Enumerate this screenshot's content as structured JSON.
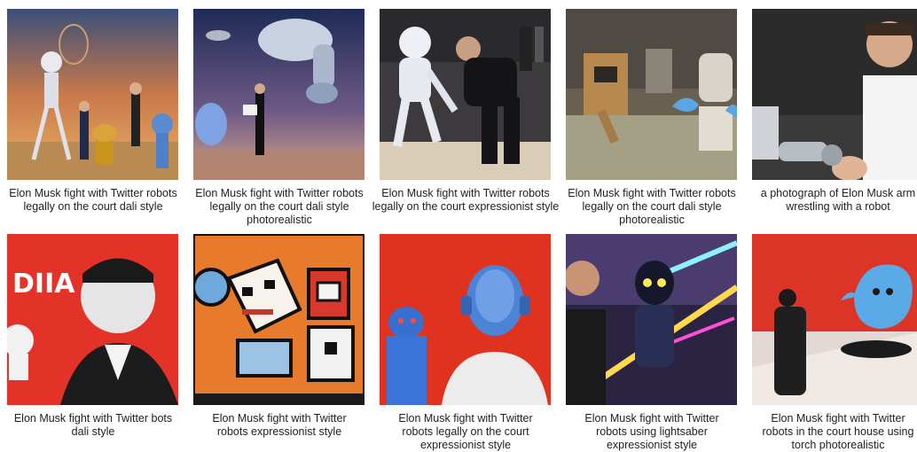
{
  "gallery": {
    "items": [
      {
        "caption": "Elon Musk fight with Twitter robots\nlegally on the court dali style",
        "image": "surreal-robot-scene"
      },
      {
        "caption": "Elon Musk fight with Twitter robots\nlegally on the court dali style\nphotorealistic",
        "image": "robot-arm-sky-scene"
      },
      {
        "caption": "Elon Musk fight with Twitter robots\nlegally on the court expressionist style",
        "image": "musk-vs-white-robot"
      },
      {
        "caption": "Elon Musk fight with Twitter robots\nlegally on the court dali style\nphotorealistic",
        "image": "robots-in-arena"
      },
      {
        "caption": "a photograph of Elon Musk arm\nwrestling with a robot",
        "image": "arm-wrestling-photo"
      },
      {
        "caption": "Elon Musk fight with Twitter bots\ndali style",
        "image": "bw-portrait-red-bg"
      },
      {
        "caption": "Elon Musk fight with Twitter\nrobots expressionist style",
        "image": "cartoon-robots"
      },
      {
        "caption": "Elon Musk fight with Twitter\nrobots legally on the court\nexpressionist style",
        "image": "blue-robot-heads"
      },
      {
        "caption": "Elon Musk fight with Twitter\nrobots using lightsaber\nexpressionist style",
        "image": "lightsaber-robot"
      },
      {
        "caption": "Elon Musk fight with Twitter\nrobots in the court house using\ntorch photorealistic",
        "image": "twitter-bird-red-room"
      }
    ]
  }
}
